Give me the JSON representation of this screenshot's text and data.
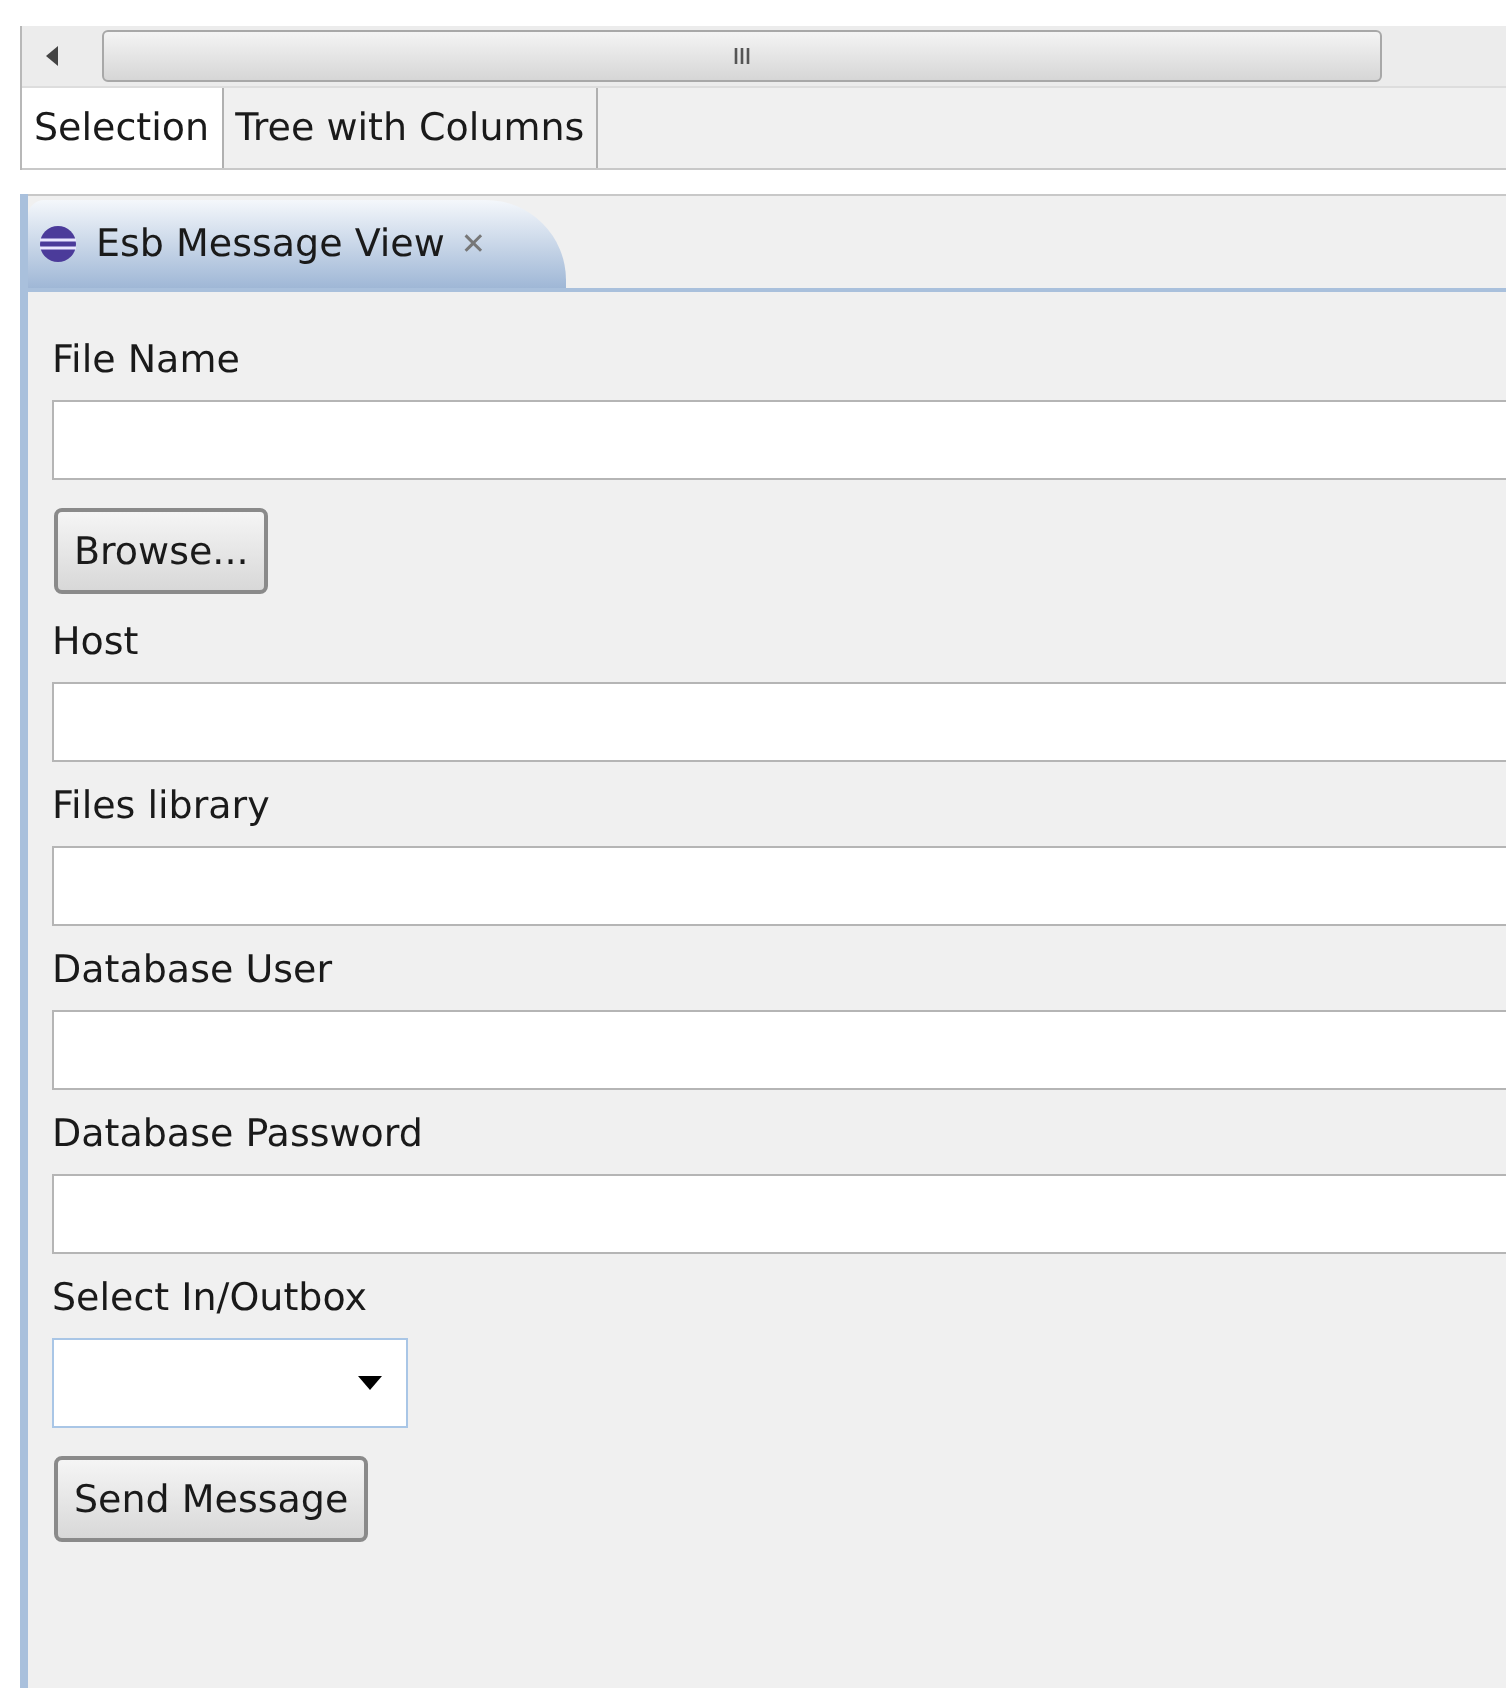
{
  "top_tabs": [
    {
      "label": "Selection",
      "selected": true
    },
    {
      "label": "Tree with Columns",
      "selected": false
    }
  ],
  "view_tab": {
    "title": "Esb Message View",
    "close": "✕"
  },
  "form": [
    {
      "kind": "label",
      "text": "File Name"
    },
    {
      "kind": "text"
    },
    {
      "kind": "button",
      "text": "Browse..."
    },
    {
      "kind": "label",
      "text": "Host"
    },
    {
      "kind": "text"
    },
    {
      "kind": "label",
      "text": "Files library"
    },
    {
      "kind": "text"
    },
    {
      "kind": "label",
      "text": "Database User"
    },
    {
      "kind": "text"
    },
    {
      "kind": "label",
      "text": "Database Password"
    },
    {
      "kind": "text"
    },
    {
      "kind": "label",
      "text": "Select In/Outbox"
    },
    {
      "kind": "combo"
    },
    {
      "kind": "button",
      "text": "Send Message"
    }
  ]
}
